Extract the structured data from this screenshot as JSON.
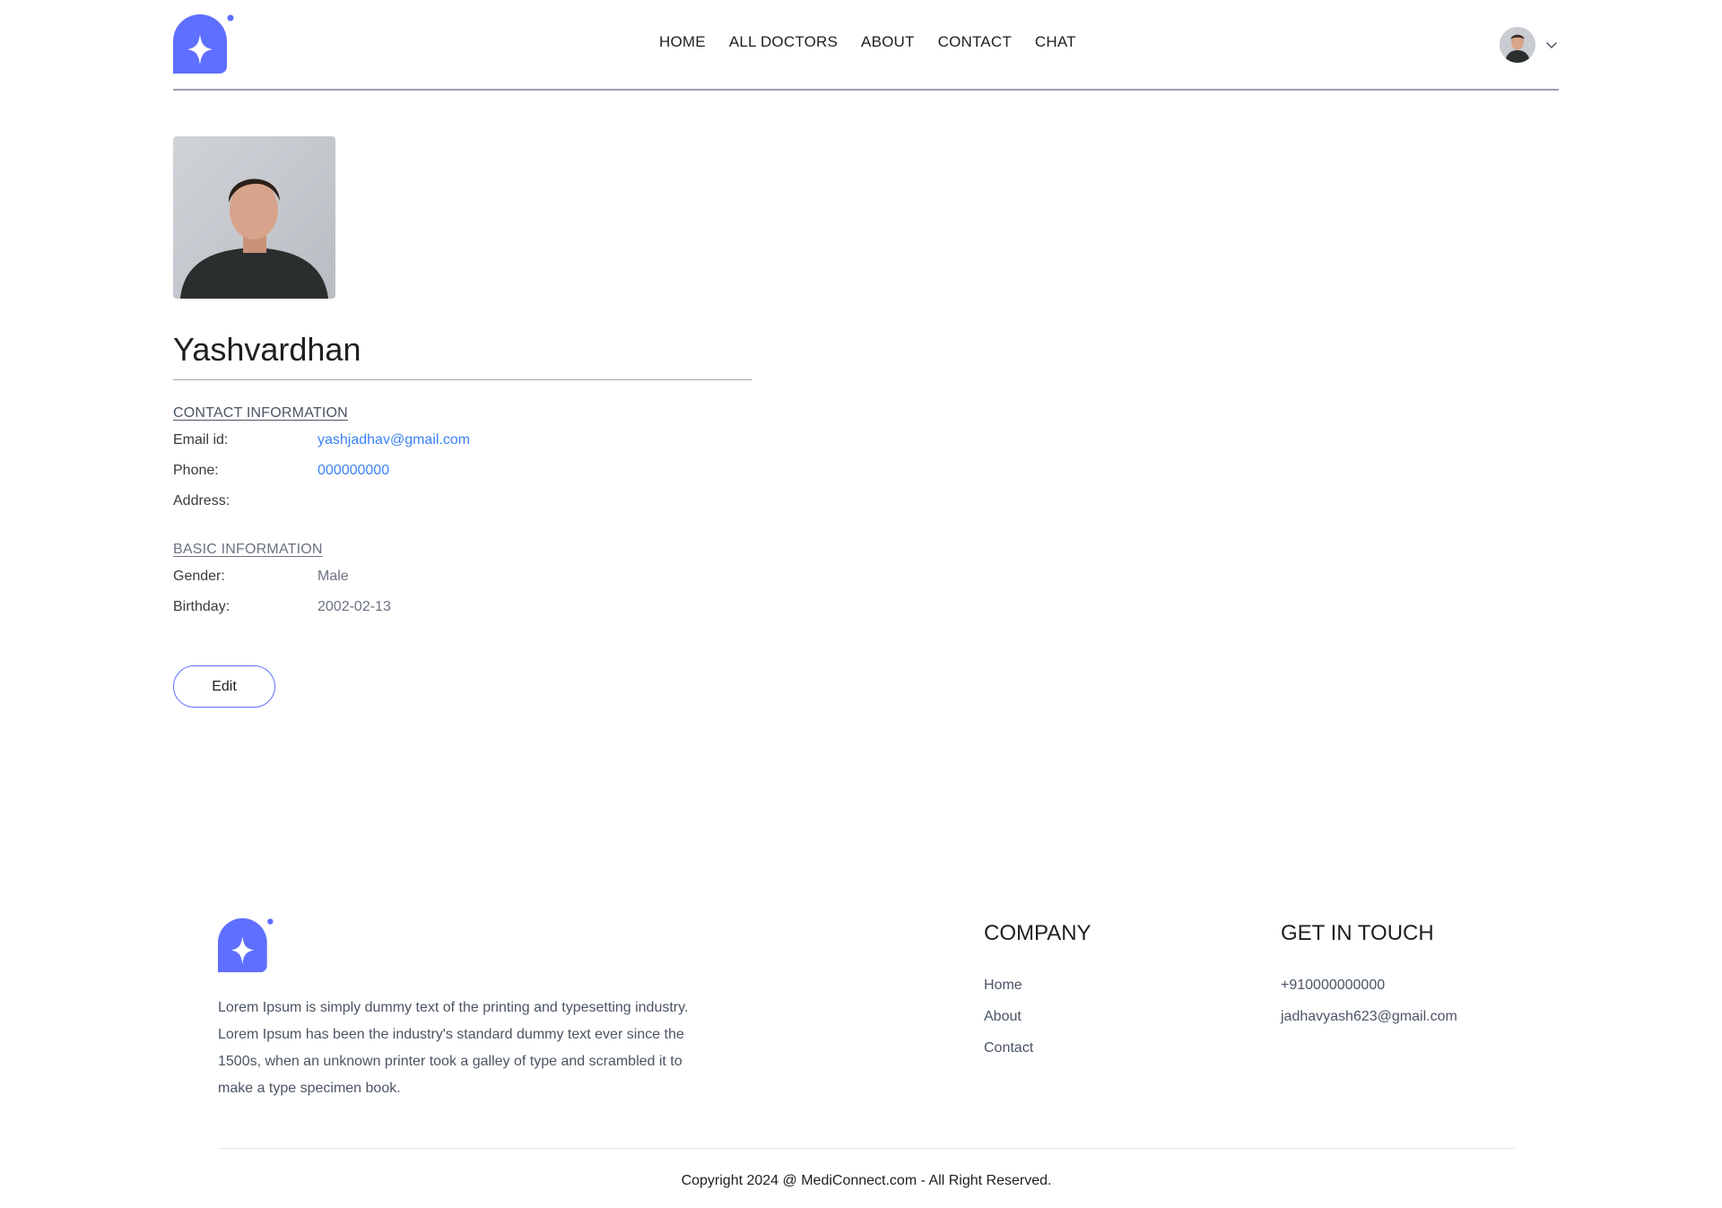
{
  "header": {
    "nav": [
      "HOME",
      "ALL DOCTORS",
      "ABOUT",
      "CONTACT",
      "CHAT"
    ]
  },
  "profile": {
    "name": "Yashvardhan",
    "contact_title": "CONTACT INFORMATION",
    "email_label": "Email id:",
    "email": "yashjadhav@gmail.com",
    "phone_label": "Phone:",
    "phone": "000000000",
    "address_label": "Address:",
    "address": "",
    "basic_title": "BASIC INFORMATION",
    "gender_label": "Gender:",
    "gender": "Male",
    "birthday_label": "Birthday:",
    "birthday": "2002-02-13",
    "edit_label": "Edit"
  },
  "footer": {
    "description": "Lorem Ipsum is simply dummy text of the printing and typesetting industry. Lorem Ipsum has been the industry's standard dummy text ever since the 1500s, when an unknown printer took a galley of type and scrambled it to make a type specimen book.",
    "company_title": "COMPANY",
    "company_links": [
      "Home",
      "About",
      "Contact"
    ],
    "touch_title": "GET IN TOUCH",
    "phone": "+910000000000",
    "email": "jadhavyash623@gmail.com",
    "copyright": "Copyright 2024 @ MediConnect.com - All Right Reserved."
  },
  "colors": {
    "brand": "#5f6fff",
    "link": "#3b82f6",
    "divider": "#9ca3af"
  },
  "icons": {
    "logo": "sparkle-arch-logo-icon",
    "dropdown": "chevron-down-icon"
  }
}
